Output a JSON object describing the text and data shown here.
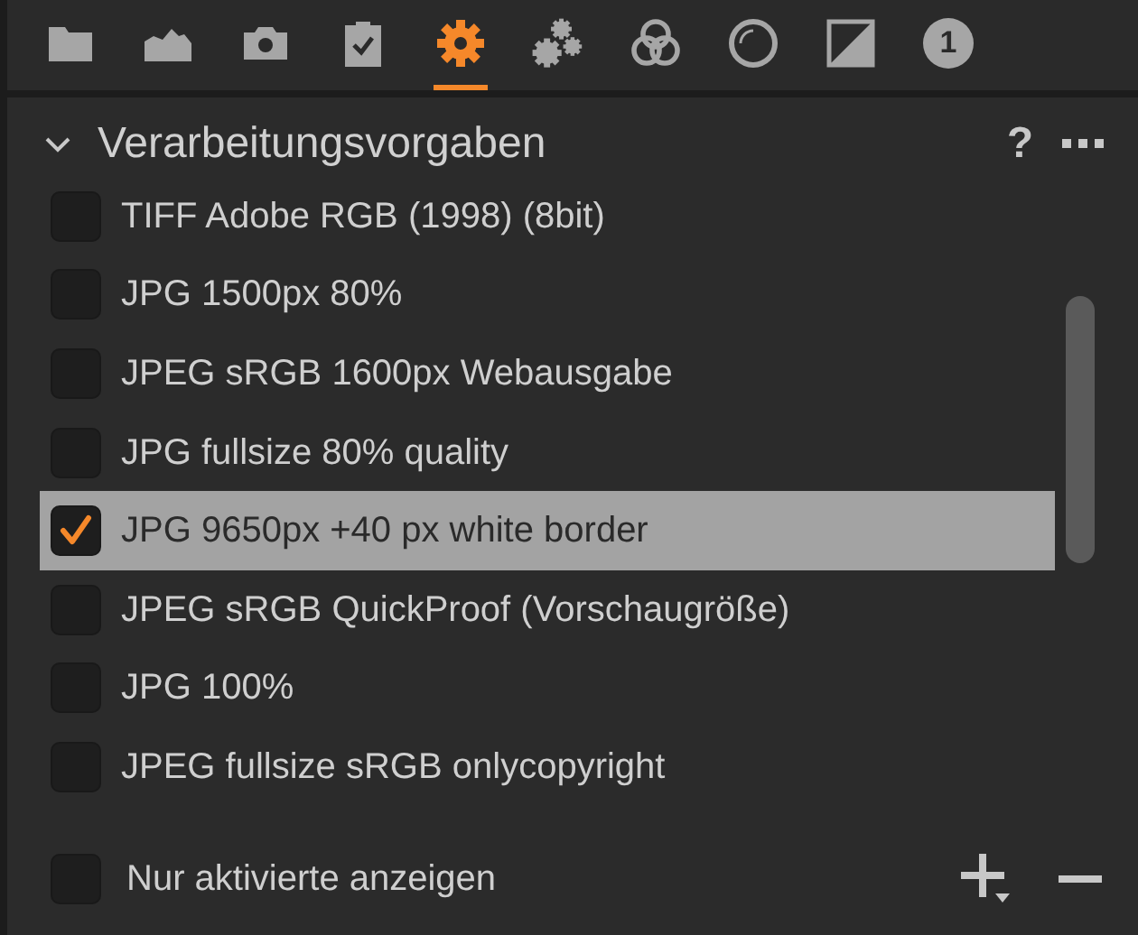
{
  "toolbar": {
    "tabs": [
      {
        "kind": "folder",
        "selected": false
      },
      {
        "kind": "histogram",
        "selected": false
      },
      {
        "kind": "camera",
        "selected": false
      },
      {
        "kind": "clipboard",
        "selected": false
      },
      {
        "kind": "gear",
        "selected": true
      },
      {
        "kind": "gears",
        "selected": false
      },
      {
        "kind": "circles",
        "selected": false
      },
      {
        "kind": "ring",
        "selected": false
      },
      {
        "kind": "square",
        "selected": false
      },
      {
        "kind": "number",
        "selected": false,
        "text": "1"
      }
    ]
  },
  "panel": {
    "title": "Verarbeitungsvorgaben",
    "expanded": true,
    "help": "?",
    "items": [
      {
        "label": "TIFF Adobe RGB (1998) (8bit)",
        "checked": false,
        "selected": false
      },
      {
        "label": "JPG 1500px 80%",
        "checked": false,
        "selected": false
      },
      {
        "label": "JPEG sRGB 1600px Webausgabe",
        "checked": false,
        "selected": false
      },
      {
        "label": "JPG fullsize 80% quality",
        "checked": false,
        "selected": false
      },
      {
        "label": "JPG 9650px +40 px white border",
        "checked": true,
        "selected": true
      },
      {
        "label": "JPEG sRGB QuickProof (Vorschaugröße)",
        "checked": false,
        "selected": false
      },
      {
        "label": "JPG 100%",
        "checked": false,
        "selected": false
      },
      {
        "label": "JPEG fullsize sRGB onlycopyright",
        "checked": false,
        "selected": false
      }
    ],
    "footer": {
      "label": "Nur aktivierte anzeigen",
      "checked": false
    }
  }
}
